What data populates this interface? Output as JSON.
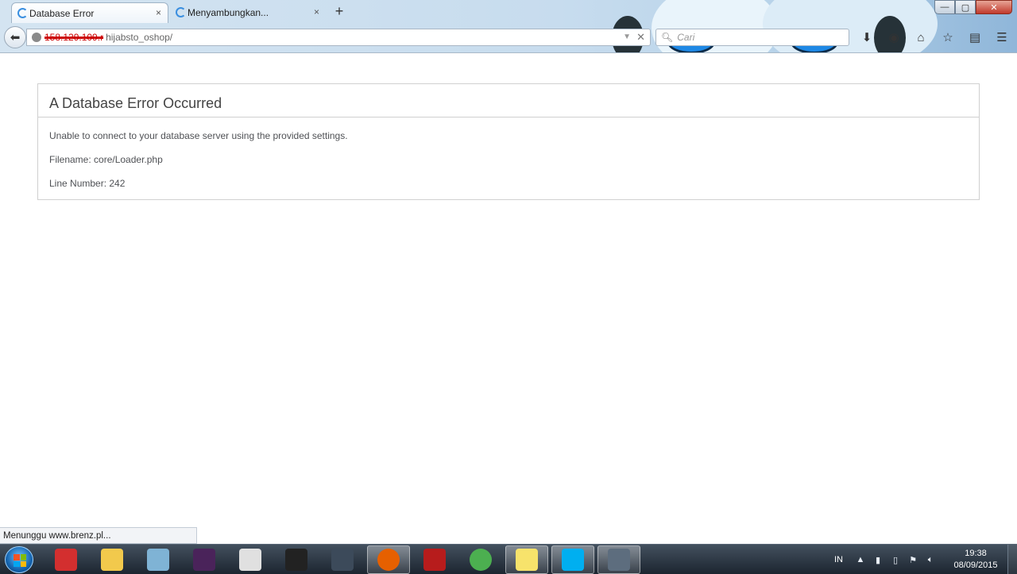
{
  "browser": {
    "tabs": [
      {
        "label": "Database Error",
        "close": "×",
        "active": true
      },
      {
        "label": "Menyambungkan...",
        "close": "×",
        "active": false
      }
    ],
    "new_tab_label": "+",
    "window_controls": {
      "minimize": "—",
      "maximize": "▢",
      "close": "✕"
    },
    "url": {
      "redacted_host": "158.129.109.r",
      "path": "hijabsto_oshop/"
    },
    "search_placeholder": "Cari",
    "nav_icons": [
      "download-icon",
      "pocket-icon",
      "home-icon",
      "star-icon",
      "reading-list-icon",
      "menu-icon"
    ]
  },
  "page": {
    "heading": "A Database Error Occurred",
    "message": "Unable to connect to your database server using the provided settings.",
    "filename": "Filename: core/Loader.php",
    "line_number": "Line Number: 242"
  },
  "status_bar": "Menunggu www.brenz.pl...",
  "taskbar": {
    "apps": [
      {
        "name": "pen-app",
        "color": "#d32f2f",
        "active": false
      },
      {
        "name": "explorer",
        "color": "#f2c94c",
        "active": false
      },
      {
        "name": "notes-app",
        "color": "#7fb3d5",
        "active": false
      },
      {
        "name": "video-app",
        "color": "#4a235a",
        "active": false
      },
      {
        "name": "pte-patch",
        "color": "#e0e0e0",
        "active": false
      },
      {
        "name": "pes-game",
        "color": "#222222",
        "active": false
      },
      {
        "name": "soldier-game",
        "color": "#3c4a5a",
        "active": false
      },
      {
        "name": "firefox",
        "color": "#e66000",
        "active": true
      },
      {
        "name": "shield-app",
        "color": "#b71c1c",
        "active": false
      },
      {
        "name": "chrome",
        "color": "#4caf50",
        "active": false
      },
      {
        "name": "sticky-notes",
        "color": "#f7e36b",
        "active": true
      },
      {
        "name": "skype",
        "color": "#00aff0",
        "active": true
      },
      {
        "name": "network-app",
        "color": "#5d6d7e",
        "active": true
      }
    ],
    "tray": {
      "language": "IN",
      "time": "19:38",
      "date": "08/09/2015"
    }
  }
}
